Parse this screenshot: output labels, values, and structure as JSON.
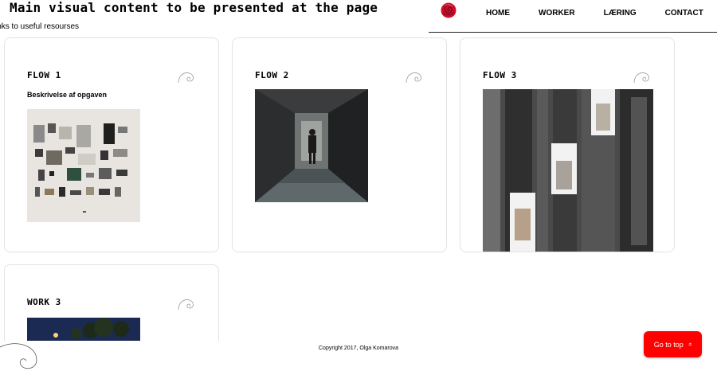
{
  "header": {
    "title": "Main visual content to be presented at the page",
    "subtitle": "inks to useful resourses"
  },
  "nav": {
    "items": [
      {
        "label": "HOME"
      },
      {
        "label": "WORKER"
      },
      {
        "label": "LÆRING"
      },
      {
        "label": "CONTACT"
      }
    ]
  },
  "cards": [
    {
      "title": "FLOW 1",
      "description": "Beskrivelse af opgaven",
      "image": "flat-lay-objects"
    },
    {
      "title": "FLOW 2",
      "image": "dark-corridor-figure"
    },
    {
      "title": "FLOW 3",
      "image": "building-facade-elevators"
    },
    {
      "title": "WORK 3",
      "image": "night-trees"
    }
  ],
  "footer": {
    "copyright": "Copyright 2017, Olga Komarova",
    "go_top_label": "Go to top",
    "go_top_icon": "double-chevron-up-icon"
  },
  "colors": {
    "accent": "#ff0000",
    "card_border": "#e3e3e3",
    "nav_rule": "#222222"
  }
}
